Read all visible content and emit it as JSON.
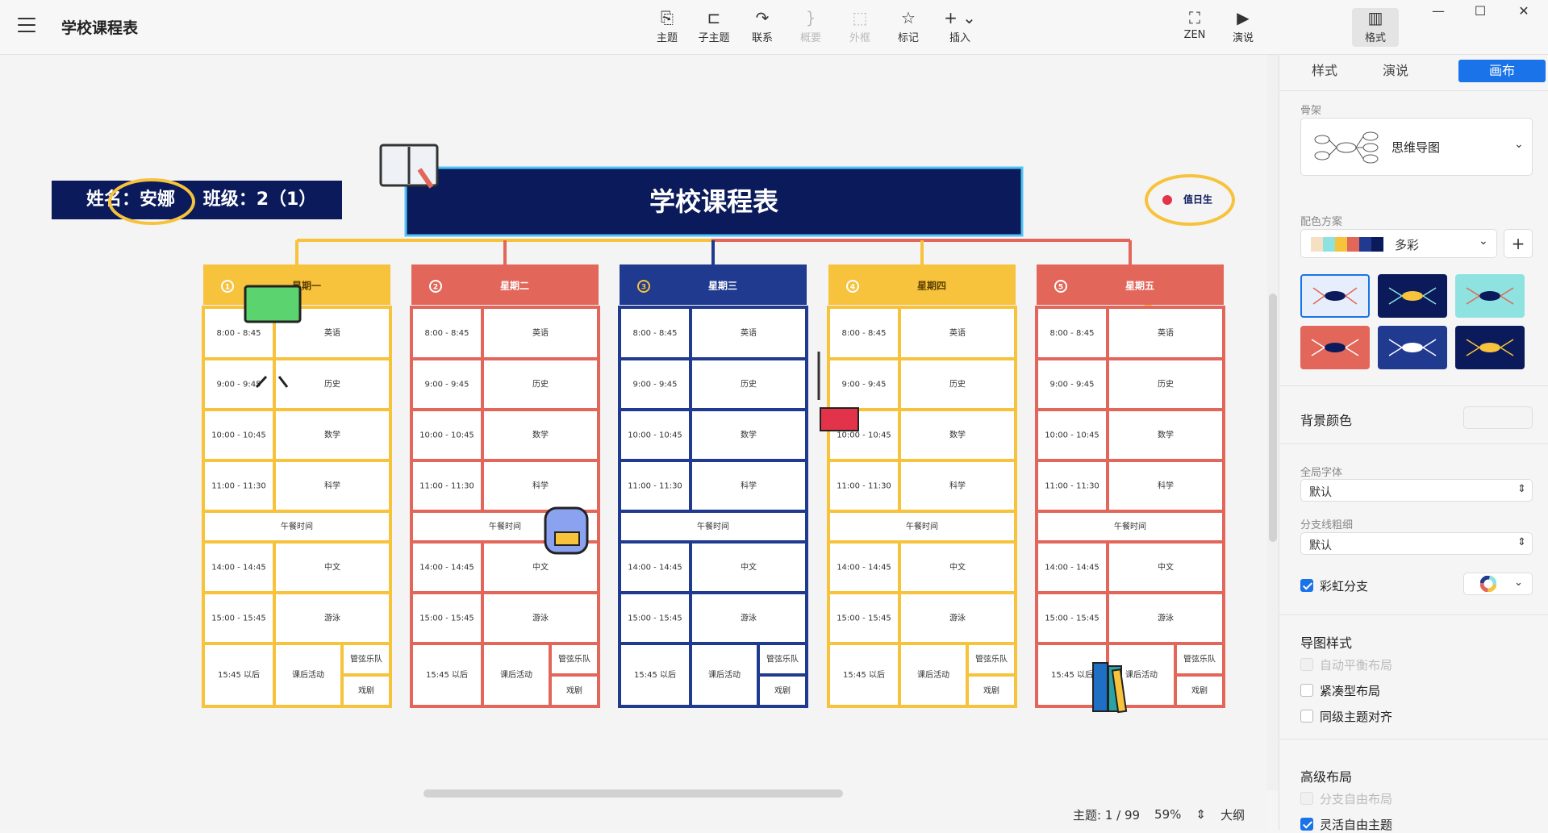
{
  "app": {
    "title": "学校课程表"
  },
  "toolbar": {
    "items": [
      {
        "label": "主题",
        "icon": "topic-icon",
        "glyph": "⎘",
        "disabled": false
      },
      {
        "label": "子主题",
        "icon": "subtopic-icon",
        "glyph": "⊏",
        "disabled": false
      },
      {
        "label": "联系",
        "icon": "relationship-icon",
        "glyph": "↷",
        "disabled": false
      },
      {
        "label": "概要",
        "icon": "summary-icon",
        "glyph": "}",
        "disabled": true
      },
      {
        "label": "外框",
        "icon": "boundary-icon",
        "glyph": "⬚",
        "disabled": true
      },
      {
        "label": "标记",
        "icon": "marker-icon",
        "glyph": "☆",
        "disabled": false
      },
      {
        "label": "插入",
        "icon": "insert-icon",
        "glyph": "+ ⌄",
        "disabled": false
      }
    ],
    "zen": {
      "label": "ZEN",
      "icon": "zen-icon",
      "glyph": "⛶"
    },
    "present": {
      "label": "演说",
      "icon": "present-icon",
      "glyph": "▶"
    },
    "format": {
      "label": "格式",
      "icon": "format-icon",
      "glyph": "▥"
    }
  },
  "window": {
    "minimize": "—",
    "maximize": "☐",
    "close": "✕"
  },
  "map": {
    "title": "学校课程表",
    "name_label": "姓名：安娜",
    "class_label": "班级：2（1）",
    "duty_label": "值日生",
    "lunch": "午餐时间",
    "days": [
      {
        "num": "1",
        "name": "星期一",
        "color": "#f7c23c"
      },
      {
        "num": "2",
        "name": "星期二",
        "color": "#e2665a"
      },
      {
        "num": "3",
        "name": "星期三",
        "color": "#1f3a8f"
      },
      {
        "num": "4",
        "name": "星期四",
        "color": "#f7c23c"
      },
      {
        "num": "5",
        "name": "星期五",
        "color": "#e2665a"
      }
    ],
    "morning": [
      {
        "time": "8:00 - 8:45",
        "subject": "英语"
      },
      {
        "time": "9:00 - 9:45",
        "subject": "历史"
      },
      {
        "time": "10:00 - 10:45",
        "subject": "数学"
      },
      {
        "time": "11:00 - 11:30",
        "subject": "科学"
      }
    ],
    "afternoon": [
      {
        "time": "14:00 - 14:45",
        "subject": "中文"
      },
      {
        "time": "15:00 - 15:45",
        "subject": "游泳"
      }
    ],
    "after_school": {
      "time": "15:45 以后",
      "activity": "课后活动",
      "options": [
        "管弦乐队",
        "戏剧"
      ]
    }
  },
  "status": {
    "topics": "主题: 1 / 99",
    "zoom": "59%",
    "outline": "大纲"
  },
  "panel": {
    "tabs": [
      "样式",
      "演说",
      "画布"
    ],
    "skeleton_label": "骨架",
    "skeleton_value": "思维导图",
    "palette_label": "配色方案",
    "palette_value": "多彩",
    "palette_add": "+",
    "palette_swatches": [
      "#f6e0c3",
      "#8ee3e0",
      "#f7c23c",
      "#e2665a",
      "#1f3a8f",
      "#0b1a5a"
    ],
    "bg_label": "背景颜色",
    "font_label": "全局字体",
    "font_value": "默认",
    "branch_width_label": "分支线粗细",
    "branch_width_value": "默认",
    "rainbow_label": "彩虹分支",
    "map_style_title": "导图样式",
    "auto_balance": "自动平衡布局",
    "compact": "紧凑型布局",
    "align_siblings": "同级主题对齐",
    "advanced_title": "高级布局",
    "free_branch": "分支自由布局",
    "flex_float": "灵活自由主题"
  }
}
